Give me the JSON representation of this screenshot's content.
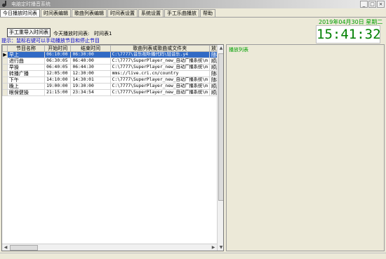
{
  "window": {
    "title": "电脑定时播音系统",
    "buttons": [
      "_",
      "□",
      "×"
    ]
  },
  "tabs": [
    "今日播放时间表",
    "时间表编辑",
    "歌曲列表编辑",
    "时间表设置",
    "系统设置",
    "手工乐曲播放",
    "帮助"
  ],
  "header": {
    "date": "2019年04月30日  星期二",
    "clock": "15:41:32",
    "import_button": "手工重导入时间表",
    "today_label": "今天播放时间表:",
    "schedule_name": "时间表1",
    "hint": "提示：鼠标右键可以手动播放节目和停止节目"
  },
  "table": {
    "columns": [
      "节目名称",
      "开始时间",
      "结束时间",
      "歌曲列表或歌曲或文件夹",
      "放方"
    ],
    "rows": [
      {
        "name": "早上",
        "start": "06:10:00",
        "end": "06:30:00",
        "list": "C:\\7777\\音乐视听播代码\\轻音乐.y4",
        "mode": "随机",
        "indicator": "▶"
      },
      {
        "name": "进行曲",
        "start": "06:30:05",
        "end": "06:40:00",
        "list": "C:\\7777\\SuperPlayer_new_自动广播系统\\m",
        "mode": "顺序",
        "indicator": ""
      },
      {
        "name": "早操",
        "start": "06:40:05",
        "end": "06:44:30",
        "list": "C:\\7777\\SuperPlayer_new_自动广播系统\\m",
        "mode": "顺序",
        "indicator": ""
      },
      {
        "name": "转播广播",
        "start": "12:05:00",
        "end": "12:30:00",
        "list": "mms://live.cri.cn/country",
        "mode": "随机",
        "indicator": ""
      },
      {
        "name": "下午",
        "start": "14:10:00",
        "end": "14:30:01",
        "list": "C:\\7777\\SuperPlayer_new_自动广播系统\\m",
        "mode": "随机",
        "indicator": ""
      },
      {
        "name": "晚上",
        "start": "19:00:00",
        "end": "19:30:00",
        "list": "C:\\7777\\SuperPlayer_new_自动广播系统\\m",
        "mode": "顺序",
        "indicator": ""
      },
      {
        "name": "眼保健操",
        "start": "21:15:00",
        "end": "23:34:54",
        "list": "C:\\7777\\SuperPlayer_new_自动广播系统\\m",
        "mode": "顺序",
        "indicator": ""
      }
    ]
  },
  "playlist": {
    "title": "播放列表"
  },
  "colors": {
    "selection": "#316ac5",
    "clock_text": "#008000",
    "hint_text": "#0000c8"
  }
}
